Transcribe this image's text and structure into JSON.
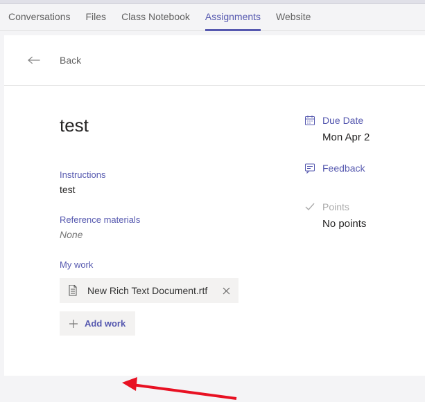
{
  "tabs": {
    "conversations": "Conversations",
    "files": "Files",
    "classNotebook": "Class Notebook",
    "assignments": "Assignments",
    "website": "Website"
  },
  "back": {
    "label": "Back"
  },
  "assignment": {
    "title": "test",
    "instructionsLabel": "Instructions",
    "instructionsValue": "test",
    "referenceLabel": "Reference materials",
    "referenceValue": "None",
    "myWorkLabel": "My work",
    "attachment": {
      "name": "New Rich Text Document.rtf"
    },
    "addWork": "Add work"
  },
  "meta": {
    "dueDateLabel": "Due Date",
    "dueDateValue": "Mon Apr 2",
    "feedbackLabel": "Feedback",
    "pointsLabel": "Points",
    "pointsValue": "No points"
  }
}
